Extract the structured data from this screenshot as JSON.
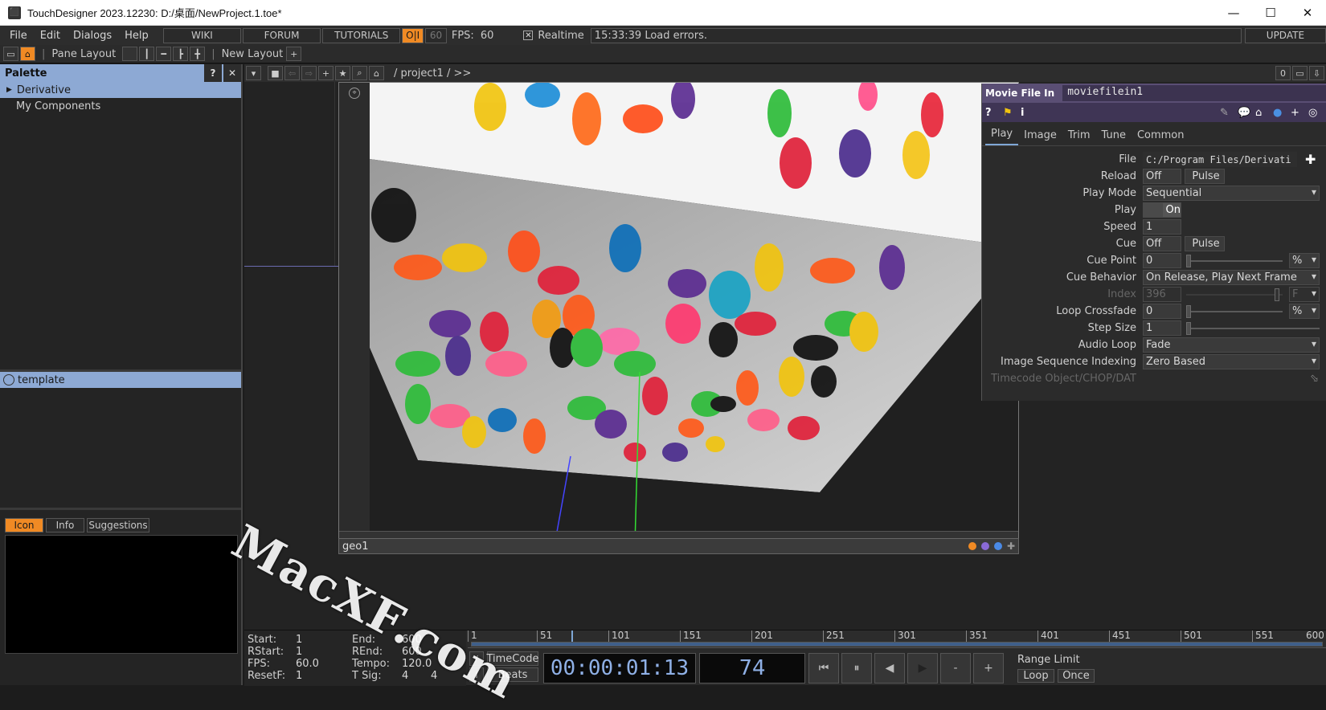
{
  "window": {
    "title": "TouchDesigner 2023.12230: D:/桌面/NewProject.1.toe*",
    "minimize_glyph": "—",
    "maximize_glyph": "☐",
    "close_glyph": "✕"
  },
  "menubar": {
    "menus": [
      "File",
      "Edit",
      "Dialogs",
      "Help"
    ],
    "links": [
      "WIKI",
      "FORUM",
      "TUTORIALS"
    ],
    "oi_label": "O|I",
    "fps_cap": "60",
    "fps_label": "FPS:",
    "fps_value": "60",
    "realtime_label": "Realtime",
    "status": "15:33:39 Load errors.",
    "update_label": "UPDATE"
  },
  "layoutbar": {
    "pane_layout_label": "Pane Layout",
    "new_layout_label": "New Layout",
    "add_glyph": "+"
  },
  "palette": {
    "title": "Palette",
    "help_glyph": "?",
    "close_glyph": "✕",
    "items": [
      "Derivative",
      "My Components"
    ],
    "template_label": "template",
    "tabs": [
      "Icon",
      "Info",
      "Suggestions"
    ]
  },
  "network": {
    "path": "/ project1 / >>",
    "geo_label": "geo1",
    "right_counter": "0"
  },
  "params": {
    "op_type": "Movie File In",
    "op_name": "moviefilein1",
    "tabs": [
      "Play",
      "Image",
      "Trim",
      "Tune",
      "Common"
    ],
    "active_tab": "Play",
    "rows": {
      "file": {
        "label": "File",
        "value": "C:/Program Files/Derivati"
      },
      "reload": {
        "label": "Reload",
        "value": "Off",
        "pulse": "Pulse"
      },
      "play_mode": {
        "label": "Play Mode",
        "value": "Sequential"
      },
      "play": {
        "label": "Play",
        "value": "On"
      },
      "speed": {
        "label": "Speed",
        "value": "1"
      },
      "cue": {
        "label": "Cue",
        "value": "Off",
        "pulse": "Pulse"
      },
      "cue_point": {
        "label": "Cue Point",
        "value": "0",
        "unit": "%"
      },
      "cue_behavior": {
        "label": "Cue Behavior",
        "value": "On Release, Play Next Frame"
      },
      "index": {
        "label": "Index",
        "value": "396",
        "unit": "F"
      },
      "loop_crossfade": {
        "label": "Loop Crossfade",
        "value": "0",
        "unit": "%"
      },
      "step_size": {
        "label": "Step Size",
        "value": "1"
      },
      "audio_loop": {
        "label": "Audio Loop",
        "value": "Fade"
      },
      "image_seq_indexing": {
        "label": "Image Sequence Indexing",
        "value": "Zero Based"
      },
      "timecode": {
        "label": "Timecode Object/CHOP/DAT"
      }
    }
  },
  "timeline": {
    "start_label": "Start:",
    "start": "1",
    "end_label": "End:",
    "end": "600",
    "rstart_label": "RStart:",
    "rstart": "1",
    "rend_label": "REnd:",
    "rend": "600",
    "fps_label": "FPS:",
    "fps": "60.0",
    "tempo_label": "Tempo:",
    "tempo": "120.0",
    "resetf_label": "ResetF:",
    "resetf": "1",
    "tsig_label": "T Sig:",
    "tsig_a": "4",
    "tsig_b": "4",
    "ticks": [
      "1",
      "51",
      "101",
      "151",
      "201",
      "251",
      "301",
      "351",
      "401",
      "451",
      "501",
      "551",
      "600"
    ],
    "timecode_label": "TimeCode",
    "beats_label": "Beats",
    "timecode": "00:00:01:13",
    "frame": "74",
    "minus": "-",
    "plus": "+",
    "range_limit_label": "Range Limit",
    "loop_label": "Loop",
    "once_label": "Once",
    "slash_a": "/",
    "slash_b": "I"
  },
  "watermark": "MacXF.com",
  "colors": {
    "accent_orange": "#f08a24",
    "palette_header": "#8da9d4",
    "param_header": "#5a4e74"
  }
}
